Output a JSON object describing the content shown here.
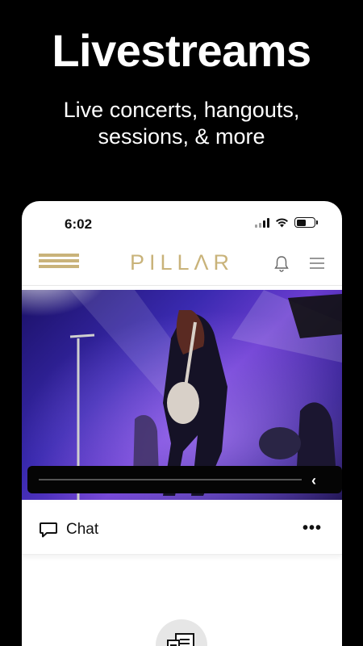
{
  "promo": {
    "title": "Livestreams",
    "subtitle": "Live concerts, hangouts, sessions, & more"
  },
  "status_bar": {
    "time": "6:02",
    "battery_level": 0.55,
    "icons": [
      "signal-icon",
      "wifi-icon",
      "battery-icon"
    ]
  },
  "app_bar": {
    "brand": "PILLΛR",
    "icons": [
      "logo-mark-icon",
      "bell-icon",
      "menu-icon"
    ]
  },
  "player": {
    "progress": 0.0,
    "icons": [
      "collapse-chevron-icon"
    ]
  },
  "chat": {
    "label": "Chat",
    "icons": [
      "chat-bubble-icon",
      "more-icon"
    ]
  },
  "colors": {
    "background": "#000000",
    "brand_gold": "#c9b37a",
    "card": "#ffffff"
  }
}
